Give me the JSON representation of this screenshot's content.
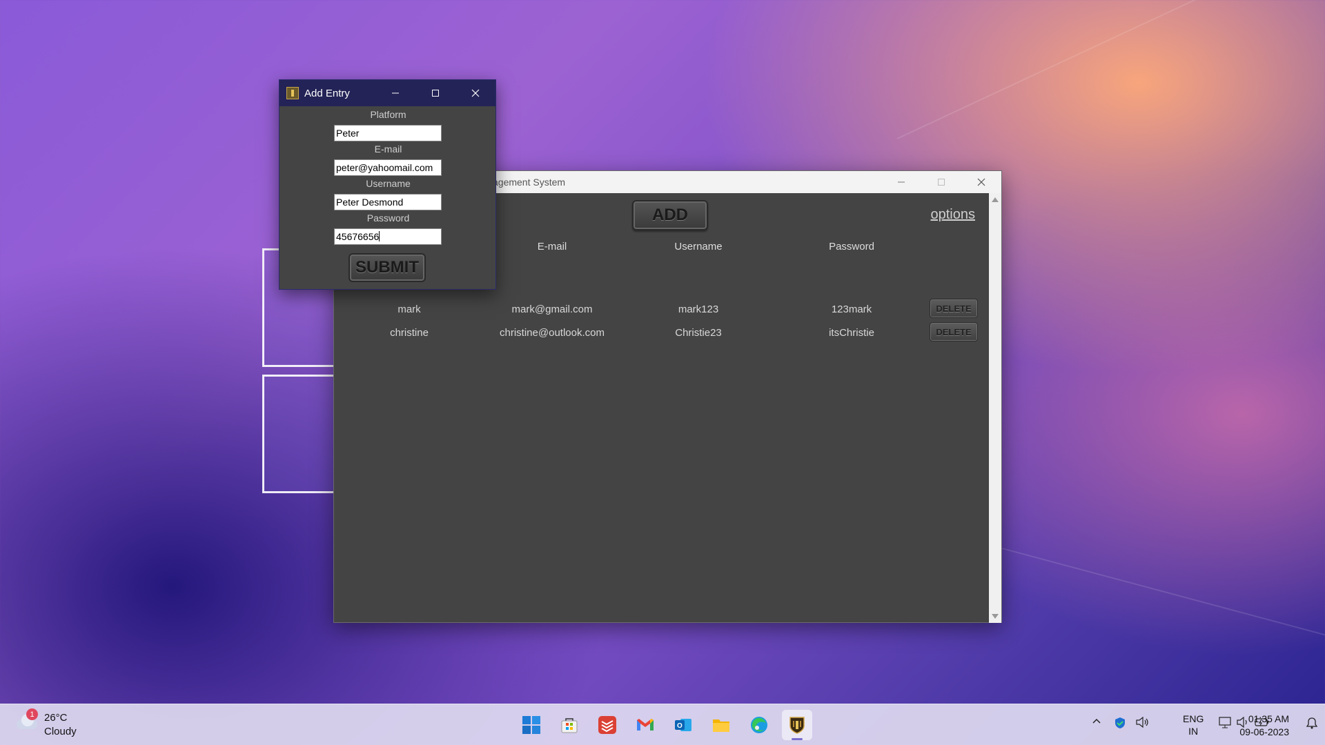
{
  "main_window": {
    "title_fragment": "agement System",
    "add_label": "ADD",
    "options_label": "options",
    "columns": [
      "E-mail",
      "Username",
      "Password"
    ],
    "rows": [
      {
        "platform": "mark",
        "email": "mark@gmail.com",
        "username": "mark123",
        "password": "123mark",
        "delete_label": "DELETE"
      },
      {
        "platform": "christine",
        "email": "christine@outlook.com",
        "username": "Christie23",
        "password": "itsChristie",
        "delete_label": "DELETE"
      }
    ]
  },
  "dialog": {
    "title": "Add Entry",
    "fields": [
      {
        "label": "Platform",
        "value": "Peter"
      },
      {
        "label": "E-mail",
        "value": "peter@yahoomail.com"
      },
      {
        "label": "Username",
        "value": "Peter Desmond"
      },
      {
        "label": "Password",
        "value": "45676656"
      }
    ],
    "submit_label": "SUBMIT"
  },
  "taskbar": {
    "weather_badge": "1",
    "weather_temp": "26°C",
    "weather_desc": "Cloudy",
    "apps": [
      "start-icon",
      "store-icon",
      "todoist-icon",
      "gmail-icon",
      "outlook-icon",
      "file-explorer-icon",
      "edge-icon",
      "password-manager-icon"
    ],
    "lang_1": "ENG",
    "lang_2": "IN",
    "time": "01:35 AM",
    "date": "09-06-2023"
  },
  "colors": {
    "dialog_titlebar": "#232357",
    "window_bg": "#444444",
    "taskbar_bg": "#dedaf0"
  }
}
